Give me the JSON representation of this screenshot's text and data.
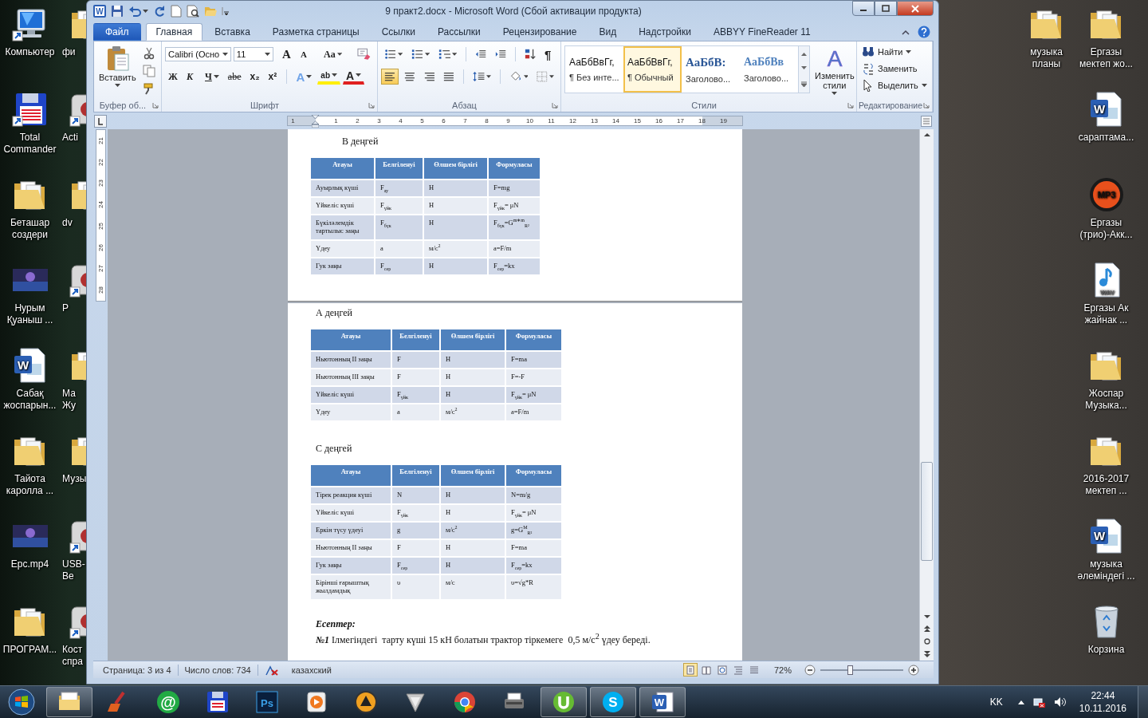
{
  "desktop": {
    "left_icons": [
      {
        "label": "Компьютер",
        "kind": "computer",
        "shortcut": true
      },
      {
        "label": "Total Commander",
        "kind": "floppy",
        "shortcut": true
      },
      {
        "label": "Беташар создери",
        "kind": "folder",
        "shortcut": false
      },
      {
        "label": "Нурым Қуаныш ...",
        "kind": "video",
        "shortcut": false
      },
      {
        "label": "Сабақ жоспарын...",
        "kind": "word",
        "glyph": "W",
        "shortcut": false
      },
      {
        "label": "Тайота каролла ...",
        "kind": "folder",
        "shortcut": false
      },
      {
        "label": "Epc.mp4",
        "kind": "video",
        "shortcut": false
      },
      {
        "label": "ПРОГРАМ...",
        "kind": "folder",
        "shortcut": false
      }
    ],
    "partial_icons": [
      {
        "label": "фи",
        "kind": "folder",
        "shortcut": false
      },
      {
        "label": "Acti",
        "kind": "app",
        "shortcut": true
      },
      {
        "label": "dv",
        "kind": "folder",
        "shortcut": false
      },
      {
        "label": "P",
        "kind": "app",
        "shortcut": true
      },
      {
        "label": "Ма Жу",
        "kind": "folder",
        "shortcut": false
      },
      {
        "label": "Музы",
        "kind": "folder",
        "shortcut": false
      },
      {
        "label": "USB- Be",
        "kind": "app",
        "shortcut": true
      },
      {
        "label": "Кост спра",
        "kind": "app",
        "shortcut": true
      }
    ],
    "right_icons_inner": [
      {
        "label": "музыка планы",
        "kind": "folder",
        "shortcut": false
      }
    ],
    "right_icons_outer": [
      {
        "label": "Ергазы мектеп жо...",
        "kind": "folder",
        "shortcut": false
      },
      {
        "label": "сараптама...",
        "kind": "word",
        "glyph": "W",
        "shortcut": false
      },
      {
        "label": "Ергазы (трио)-Акк...",
        "kind": "mp3",
        "glyph": "MP3",
        "shortcut": false
      },
      {
        "label": "Ергазы Ак жайнак ...",
        "kind": "wav",
        "glyph": "WAV",
        "shortcut": false
      },
      {
        "label": "Жоспар Музыка...",
        "kind": "folder",
        "shortcut": false
      },
      {
        "label": "2016-2017 мектеп ...",
        "kind": "folder",
        "shortcut": false
      },
      {
        "label": "музыка әлеміндегі ...",
        "kind": "word",
        "glyph": "W",
        "shortcut": false
      },
      {
        "label": "Корзина",
        "kind": "bin",
        "shortcut": false
      }
    ]
  },
  "window": {
    "title": "9 практ2.docx - Microsoft Word (Сбой активации продукта)",
    "app_glyph": "W",
    "tabs": [
      {
        "label": "Файл",
        "kind": "file",
        "selected": false
      },
      {
        "label": "Главная",
        "kind": "tab",
        "selected": true
      },
      {
        "label": "Вставка",
        "kind": "tab",
        "selected": false
      },
      {
        "label": "Разметка страницы",
        "kind": "tab",
        "selected": false
      },
      {
        "label": "Ссылки",
        "kind": "tab",
        "selected": false
      },
      {
        "label": "Рассылки",
        "kind": "tab",
        "selected": false
      },
      {
        "label": "Рецензирование",
        "kind": "tab",
        "selected": false
      },
      {
        "label": "Вид",
        "kind": "tab",
        "selected": false
      },
      {
        "label": "Надстройки",
        "kind": "tab",
        "selected": false
      },
      {
        "label": "ABBYY FineReader 11",
        "kind": "tab",
        "selected": false
      }
    ]
  },
  "ribbon": {
    "clipboard": {
      "paste_label": "Вставить",
      "group_label": "Буфер об..."
    },
    "font": {
      "name": "Calibri (Осно",
      "size": "11",
      "top_buttons": [
        {
          "glyph": "A",
          "kind": "grow"
        },
        {
          "glyph": "A",
          "kind": "shrink"
        },
        {
          "glyph": "Aa",
          "kind": "case"
        }
      ],
      "bottom_buttons": [
        {
          "glyph": "Ж",
          "kind": "bold"
        },
        {
          "glyph": "К",
          "kind": "italic"
        },
        {
          "glyph": "Ч",
          "kind": "underline"
        },
        {
          "glyph": "abe",
          "kind": "strike"
        },
        {
          "glyph": "x₂",
          "kind": "sub"
        },
        {
          "glyph": "x²",
          "kind": "sup"
        },
        {
          "glyph": "A",
          "kind": "effects"
        },
        {
          "glyph": "ab",
          "kind": "highlight"
        },
        {
          "glyph": "A",
          "kind": "color"
        }
      ],
      "group_label": "Шрифт"
    },
    "paragraph": {
      "show_marks_glyph": "¶",
      "group_label": "Абзац",
      "alignment": [
        {
          "kind": "left",
          "selected": true
        },
        {
          "kind": "center",
          "selected": false
        },
        {
          "kind": "right",
          "selected": false
        },
        {
          "kind": "justify",
          "selected": false
        }
      ]
    },
    "styles": {
      "gallery": [
        {
          "sample": "АаБбВвГг,",
          "name": "¶ Без инте...",
          "kind": "normal",
          "selected": false
        },
        {
          "sample": "АаБбВвГг,",
          "name": "¶ Обычный",
          "kind": "normal",
          "selected": true
        },
        {
          "sample": "АаБбВ:",
          "name": "Заголово...",
          "kind": "heading1",
          "selected": false
        },
        {
          "sample": "АаБбВв",
          "name": "Заголово...",
          "kind": "heading2",
          "selected": false
        }
      ],
      "change_glyph": "A",
      "change_label": "Изменить стили",
      "group_label": "Стили"
    },
    "editing": {
      "items": [
        {
          "label": "Найти",
          "kind": "find",
          "dropdown": true
        },
        {
          "label": "Заменить",
          "kind": "replace",
          "dropdown": false
        },
        {
          "label": "Выделить",
          "kind": "select",
          "dropdown": true
        }
      ],
      "group_label": "Редактирование"
    }
  },
  "ruler": {
    "horizontal": [
      "1",
      "1",
      "2",
      "3",
      "4",
      "5",
      "6",
      "7",
      "8",
      "9",
      "10",
      "11",
      "12",
      "13",
      "14",
      "15",
      "16",
      "17",
      "18",
      "19"
    ],
    "vertical": [
      "21",
      "22",
      "23",
      "24",
      "25",
      "26",
      "27",
      "28"
    ]
  },
  "document": {
    "page_end": [
      {
        "kind": "heading",
        "text": "В деңгей"
      },
      {
        "kind": "table",
        "columns": [
          "Атауы",
          "Белгіленуі",
          "Өлшем бірлігі",
          "Формуласы"
        ],
        "rows": [
          [
            "Ауырлық күші",
            "F$_{ау}$",
            "Н",
            "F=mg"
          ],
          [
            "Үйкеліс күші",
            "F$_{үйк}$",
            "Н",
            "F$_{үйк}$= μN"
          ],
          [
            "Бүкіләлемдік тартылыс заңы",
            "F$_{бүк}$",
            "Н",
            "F$_{бүк}$=G$^{m∗m}$$_{R²}$"
          ],
          [
            "Үдеу",
            "a",
            "м/с$^{2}$",
            "a=F/m"
          ],
          [
            "Гук заңы",
            "F$_{сер}$",
            "Н",
            "F$_{сер}$=kx"
          ]
        ]
      }
    ],
    "page": [
      {
        "kind": "heading",
        "text": "А деңгей"
      },
      {
        "kind": "table",
        "columns": [
          "Атауы",
          "Белгіленуі",
          "Өлшем бірлігі",
          "Формуласы"
        ],
        "rows": [
          [
            "Ньютонның ІІ заңы",
            "F",
            "Н",
            "F=ma"
          ],
          [
            "Ньютонның ІІІ заңы",
            "F",
            "Н",
            "F=-F"
          ],
          [
            "Үйкеліс күші",
            "F$_{үйк}$",
            "Н",
            "F$_{үйк}$= μN"
          ],
          [
            "Үдеу",
            "a",
            "м/с$^{2}$",
            "a=F/m"
          ]
        ]
      },
      {
        "kind": "heading",
        "text": "С деңгей"
      },
      {
        "kind": "table",
        "columns": [
          "Атауы",
          "Белгіленуі",
          "Өлшем бірлігі",
          "Формуласы"
        ],
        "rows": [
          [
            "Тірек реакция күші",
            "N",
            "Н",
            "N=m/g"
          ],
          [
            "Үйкеліс күші",
            "F$_{үйк}$",
            "Н",
            "F$_{үйк}$= μN"
          ],
          [
            "Еркін түсу үдеуі",
            "g",
            "м/с$^{2}$",
            "g=G$^{M}$$_{R²}$"
          ],
          [
            "Ньютонның ІІ заңы",
            "F",
            "Н",
            "F=ma"
          ],
          [
            "Гук заңы",
            "F$_{сер}$",
            "Н",
            "F$_{сер}$=kx"
          ],
          [
            "Бірінші ғарыштық жылдамдық",
            "υ",
            "м/с",
            "υ=√g*R"
          ]
        ]
      },
      {
        "kind": "subtitle",
        "text": "Есептер:"
      },
      {
        "kind": "paragraph",
        "text": "**№1** Ілмегіндегі  тарту күші 15 кН болатын трактор тіркемеге  0,5 м/с$^{2}$ үдеу береді."
      }
    ]
  },
  "status_bar": {
    "page": "Страница: 3 из 4",
    "words": "Число слов: 734",
    "language": "казахский",
    "zoom": "72%",
    "views": [
      {
        "kind": "print",
        "selected": true
      },
      {
        "kind": "reading",
        "selected": false
      },
      {
        "kind": "web",
        "selected": false
      },
      {
        "kind": "outline",
        "selected": false
      },
      {
        "kind": "draft",
        "selected": false
      }
    ],
    "zoom_slider": {
      "level": 0.36
    }
  },
  "taskbar": {
    "apps": [
      {
        "kind": "explorer",
        "running": true
      },
      {
        "kind": "ccleaner",
        "running": false
      },
      {
        "kind": "mail",
        "glyph": "@",
        "running": false
      },
      {
        "kind": "floppy",
        "running": false
      },
      {
        "kind": "photoshop",
        "glyph": "Ps",
        "running": false
      },
      {
        "kind": "player",
        "running": false
      },
      {
        "kind": "aimp",
        "running": false
      },
      {
        "kind": "shape",
        "running": false
      },
      {
        "kind": "chrome",
        "running": false
      },
      {
        "kind": "scanner",
        "running": false
      },
      {
        "kind": "torrent",
        "running": true
      },
      {
        "kind": "skype",
        "glyph": "S",
        "running": true
      },
      {
        "kind": "word",
        "glyph": "W",
        "running": true
      }
    ],
    "language": "KK",
    "time": "22:44",
    "date": "10.11.2016"
  }
}
